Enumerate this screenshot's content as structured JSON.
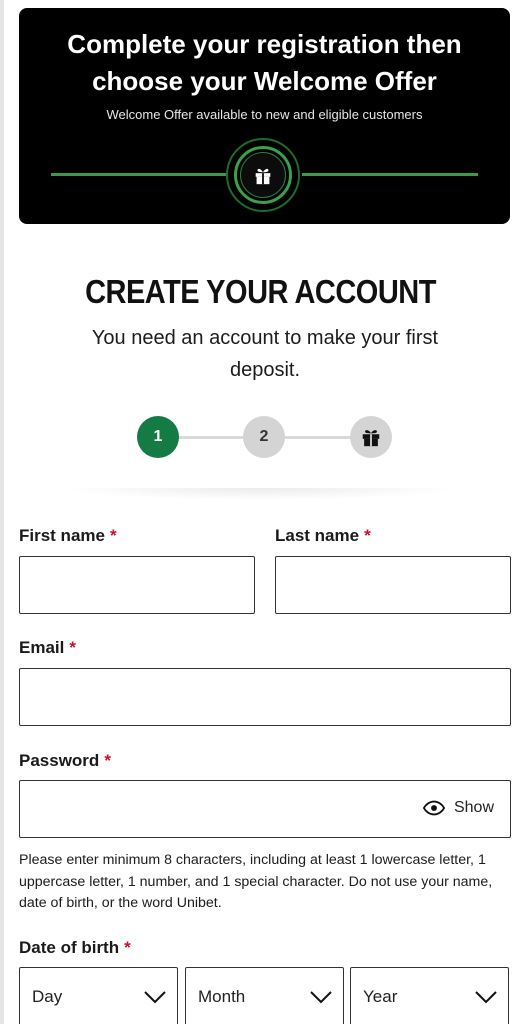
{
  "banner": {
    "title": "Complete your registration then choose your Welcome Offer",
    "subtitle": "Welcome Offer available to new and eligible customers",
    "icon": "gift-icon"
  },
  "heading": {
    "title": "CREATE YOUR ACCOUNT",
    "subtitle": "You need an account to make your first deposit."
  },
  "stepper": {
    "steps": [
      {
        "label": "1",
        "state": "active"
      },
      {
        "label": "2",
        "state": "upcoming"
      },
      {
        "label": "",
        "icon": "gift-icon",
        "state": "upcoming"
      }
    ],
    "active_color": "#147b45"
  },
  "form": {
    "required_mark": "*",
    "first_name": {
      "label": "First name",
      "value": ""
    },
    "last_name": {
      "label": "Last name",
      "value": ""
    },
    "email": {
      "label": "Email",
      "value": ""
    },
    "password": {
      "label": "Password",
      "value": "",
      "show_label": "Show",
      "hint": "Please enter minimum 8 characters, including at least 1 lowercase letter, 1 uppercase letter, 1 number, and 1 special character. Do not use your name, date of birth, or the word Unibet."
    },
    "dob": {
      "label": "Date of birth",
      "day": "Day",
      "month": "Month",
      "year": "Year"
    }
  },
  "colors": {
    "accent_green": "#147b45",
    "banner_line": "#3a9a45",
    "required_red": "#c8102e"
  }
}
